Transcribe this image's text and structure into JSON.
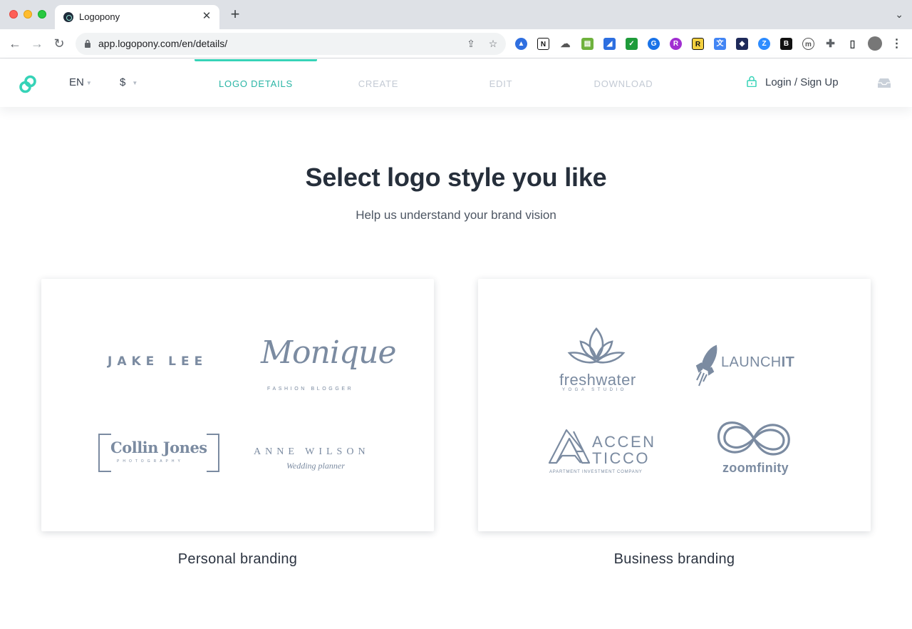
{
  "browser": {
    "tab_title": "Logopony",
    "url": "app.logopony.com/en/details/"
  },
  "header": {
    "language": "EN",
    "currency": "$",
    "steps": [
      {
        "label": "LOGO DETAILS",
        "active": true
      },
      {
        "label": "CREATE",
        "active": false
      },
      {
        "label": "EDIT",
        "active": false
      },
      {
        "label": "DOWNLOAD",
        "active": false
      }
    ],
    "login_label": "Login / Sign Up"
  },
  "main": {
    "title": "Select logo style you like",
    "subtitle": "Help us understand your brand vision",
    "cards": [
      {
        "label": "Personal branding",
        "samples": {
          "jake_lee": "JAKE LEE",
          "monique": "Monique",
          "monique_tag": "FASHION BLOGGER",
          "collin": "Collin Jones",
          "collin_tag": "PHOTOGRAPHY",
          "anne": "ANNE WILSON",
          "anne_tag": "Wedding planner"
        }
      },
      {
        "label": "Business branding",
        "samples": {
          "freshwater": "freshwater",
          "freshwater_tag": "YOGA STUDIO",
          "launch_a": "LAUNCH",
          "launch_b": "IT",
          "accen": "ACCEN",
          "ticco": "TICCO",
          "accen_tag": "APARTMENT INVESTMENT COMPANY",
          "zoomfinity": "zoomfinity"
        }
      }
    ]
  },
  "colors": {
    "accent": "#36d3b7",
    "active_step": "#2ab5a5",
    "inactive_step": "#c3cad4",
    "logo_gray": "#7b8ba1"
  }
}
